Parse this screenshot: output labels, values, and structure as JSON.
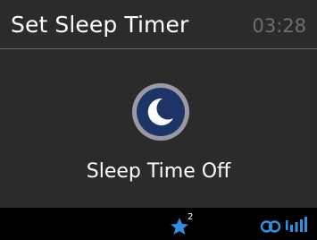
{
  "header": {
    "title": "Set Sleep Timer",
    "time": "03:28"
  },
  "main": {
    "icon": "moon-icon",
    "status_text": "Sleep Time Off"
  },
  "statusbar": {
    "favorite_icon": "star-icon",
    "favorite_count": "2",
    "stereo_icon": "stereo-icon",
    "signal_icon": "signal-strength-icon"
  },
  "colors": {
    "background": "#2b2b2b",
    "statusbar_background": "#000000",
    "moon_disc": "#1e3366",
    "moon_ring": "#9a9aa6",
    "accent_blue": "#2f8fe0",
    "clock_gray": "#6f6f6f"
  }
}
